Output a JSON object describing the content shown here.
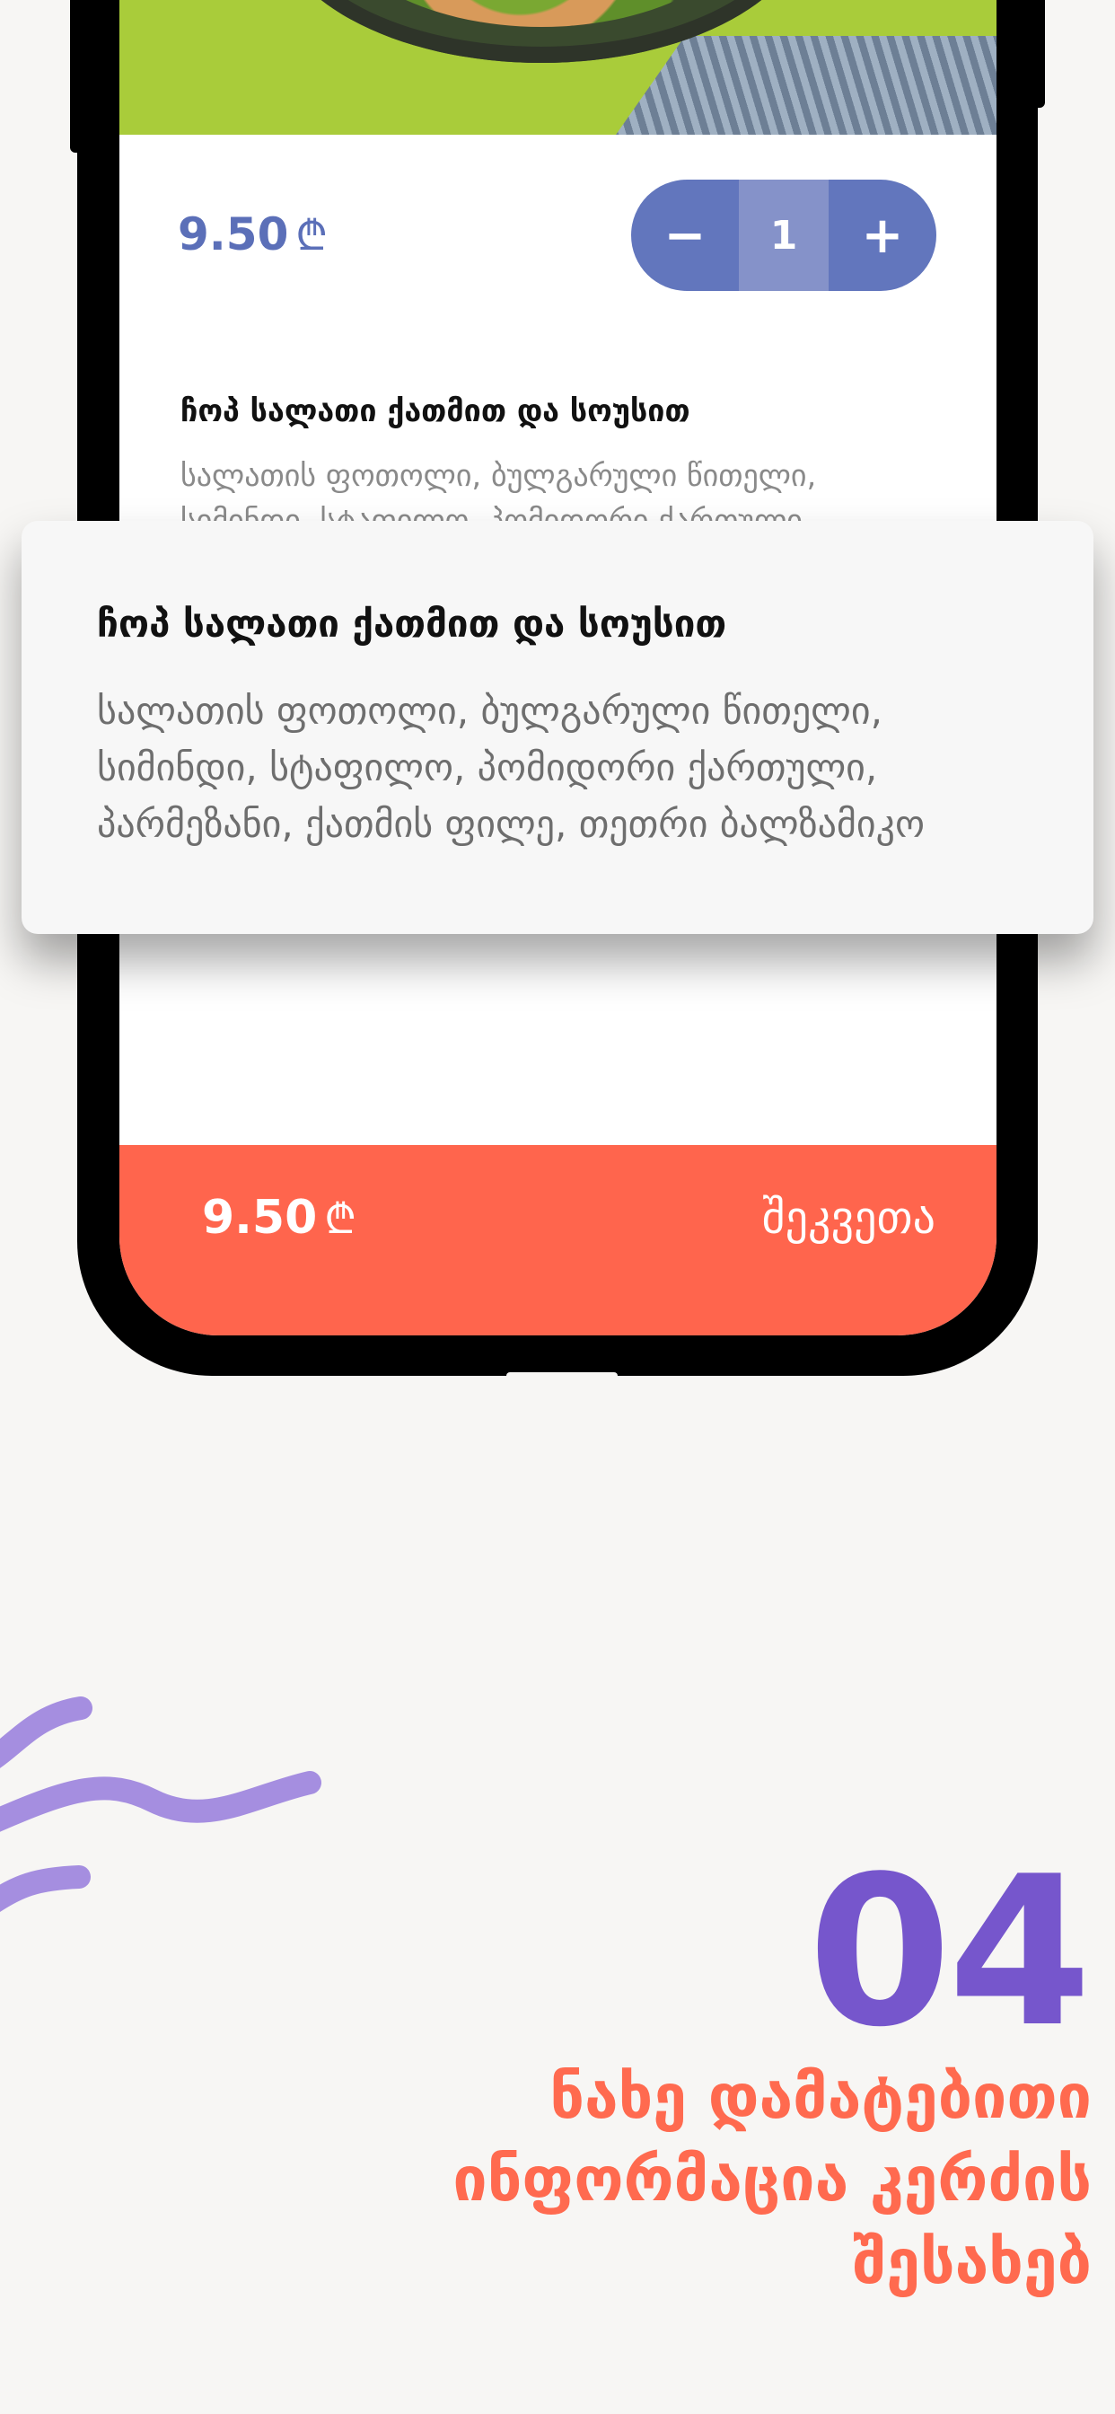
{
  "product": {
    "price": "9.50",
    "currency_symbol": "₾",
    "quantity": "1",
    "decrease_label": "−",
    "increase_label": "+",
    "title": "ჩოპ სალათი ქათმით და სოუსით",
    "description": "სალათის ფოთოლი, ბულგარული წითელი, სიმინდი, სტაფილო, პომიდორი ქართული, პარმეზანი, ქათმის ფილე, თეთრი ბალზამიკო"
  },
  "popup": {
    "title": "ჩოპ სალათი ქათმით და სოუსით",
    "description": "სალათის ფოთოლი, ბულგარული წითელი, სიმინდი, სტაფილო, პომიდორი ქართული, პარმეზანი, ქათმის ფილე, თეთრი ბალზამიკო"
  },
  "order_bar": {
    "price": "9.50",
    "currency_symbol": "₾",
    "order_label": "შეკვეთა"
  },
  "promo": {
    "step_number": "04",
    "caption": "ნახე დამატებითი ინფორმაცია კერძის შესახებ"
  },
  "colors": {
    "accent_blue": "#6276bd",
    "order_bar": "#ff654d",
    "step_number": "#7656cc",
    "caption": "#ff6a4f",
    "squiggle": "#a58ee0"
  }
}
